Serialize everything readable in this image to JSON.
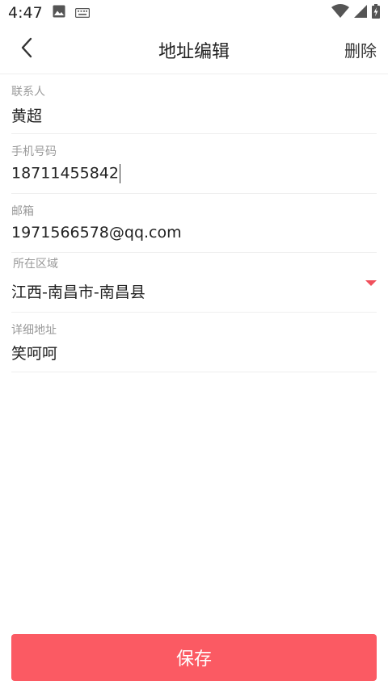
{
  "status_bar": {
    "time": "4:47"
  },
  "header": {
    "title": "地址编辑",
    "delete_label": "删除"
  },
  "form": {
    "contact": {
      "label": "联系人",
      "value": "黄超"
    },
    "phone": {
      "label": "手机号码",
      "value": "18711455842"
    },
    "email": {
      "label": "邮箱",
      "value": "1971566578@qq.com"
    },
    "region": {
      "label": "所在区域",
      "value": "江西-南昌市-南昌县"
    },
    "address": {
      "label": "详细地址",
      "value": "笑呵呵"
    }
  },
  "save_label": "保存",
  "colors": {
    "accent": "#fb5a63",
    "dropdown_arrow": "#f0505c"
  },
  "icons": {
    "status_left": [
      "image-icon",
      "keyboard-icon"
    ],
    "status_right": [
      "wifi-icon",
      "signal-icon",
      "battery-charging-icon"
    ],
    "header": [
      "back-arrow-icon"
    ],
    "region": [
      "dropdown-arrow-icon"
    ]
  }
}
